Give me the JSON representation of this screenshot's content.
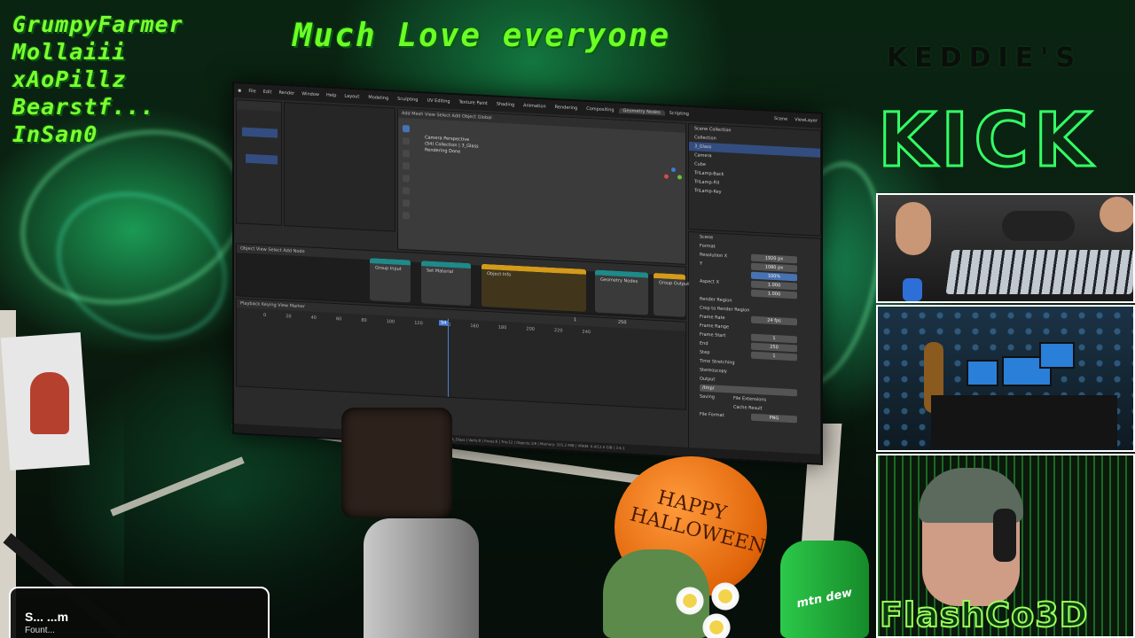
{
  "overlay": {
    "names": [
      "GrumpyFarmer",
      "Mollaiii",
      "xAoPillz",
      "Bearstf...",
      "InSan0"
    ],
    "headline": "Much Love everyone",
    "kick_subtitle": "KEDDIE'S",
    "kick_title": "KICK",
    "brand": "FlashCo3D",
    "balloon_text": "HAPPY HALLOWEEN",
    "bottle_text": "mtn dew",
    "now_playing": {
      "title": "S... ...m",
      "subtitle": "Fount..."
    }
  },
  "blender": {
    "menu": [
      "File",
      "Edit",
      "Render",
      "Window",
      "Help"
    ],
    "workspaces": [
      "Layout",
      "Modeling",
      "Sculpting",
      "UV Editing",
      "Texture Paint",
      "Shading",
      "Animation",
      "Rendering",
      "Compositing",
      "Geometry Nodes",
      "Scripting"
    ],
    "active_workspace": "Geometry Nodes",
    "scene_label": "Scene",
    "view_layer_label": "ViewLayer",
    "viewport_header": "Add Mesh   View   Select   Add   Object   Global",
    "viewport_info": [
      "Camera Perspective",
      "(54) Collection | 3_Glass",
      "Rendering Done"
    ],
    "outliner": {
      "title": "Scene Collection",
      "items": [
        {
          "label": "Collection",
          "selected": false
        },
        {
          "label": "3_Glass",
          "selected": true
        },
        {
          "label": "Camera",
          "selected": false
        },
        {
          "label": "Cube",
          "selected": false
        },
        {
          "label": "TriLamp-Back",
          "selected": false
        },
        {
          "label": "TriLamp-Fill",
          "selected": false
        },
        {
          "label": "TriLamp-Key",
          "selected": false
        }
      ]
    },
    "properties": {
      "tab": "Scene",
      "section_format": "Format",
      "resolution_x_label": "Resolution X",
      "resolution_x": "1920 px",
      "resolution_y_label": "Y",
      "resolution_y": "1080 px",
      "percent": "100%",
      "aspect_x_label": "Aspect X",
      "aspect_x": "1.000",
      "aspect_y": "1.000",
      "render_region": "Render Region",
      "crop": "Crop to Render Region",
      "frame_rate_label": "Frame Rate",
      "frame_rate": "24 fps",
      "section_frame_range": "Frame Range",
      "frame_start_label": "Frame Start",
      "frame_start": "1",
      "end_label": "End",
      "end": "250",
      "step_label": "Step",
      "step": "1",
      "time_stretching": "Time Stretching",
      "stereoscopy": "Stereoscopy",
      "section_output": "Output",
      "output_path": "/tmp/",
      "saving_label": "Saving",
      "file_extensions": "File Extensions",
      "cache_result": "Cache Result",
      "file_format_label": "File Format",
      "file_format": "PNG"
    },
    "nodes_header": "Object   View   Select   Add   Node",
    "nodes": [
      "Group Input",
      "Set Material",
      "Object Info",
      "Geometry Nodes",
      "Group Output"
    ],
    "timeline_header": "Playback   Keying   View   Marker",
    "timeline_ticks": [
      "0",
      "20",
      "40",
      "60",
      "80",
      "100",
      "120",
      "140",
      "160",
      "180",
      "200",
      "220",
      "240"
    ],
    "current_frame": "54",
    "start_field": "1",
    "end_field": "250",
    "statusbar": "Collection | 3_Glass | Verts:8 | Faces:6 | Tris:12 | Objects:1/6 | Memory: 101.2 MiB | VRAM: 0.4/12.0 GiB | 3.6.1"
  },
  "colors": {
    "accent_green": "#7CFF2E",
    "blender_select": "#334d80",
    "node_orange": "#d49a1a",
    "node_teal": "#1e8a8a"
  }
}
